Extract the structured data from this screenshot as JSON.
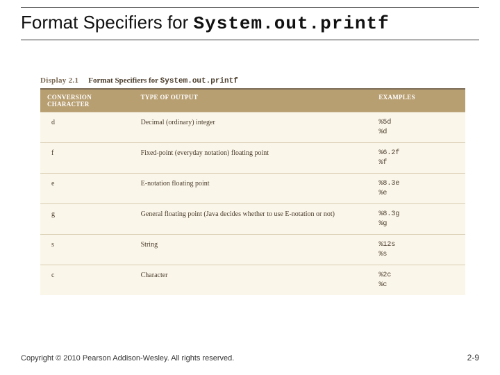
{
  "title": {
    "prefix": "Format Specifiers for ",
    "mono": "System.out.printf"
  },
  "display": {
    "label": "Display 2.1",
    "caption_prefix": "Format Specifiers for ",
    "caption_mono": "System.out.printf"
  },
  "headers": {
    "col1a": "CONVERSION",
    "col1b": "CHARACTER",
    "col2": "TYPE OF OUTPUT",
    "col3": "EXAMPLES"
  },
  "rows": [
    {
      "ch": "d",
      "type": "Decimal (ordinary) integer",
      "ex": "%5d\n%d"
    },
    {
      "ch": "f",
      "type": "Fixed-point (everyday notation) floating point",
      "ex": "%6.2f\n%f"
    },
    {
      "ch": "e",
      "type": "E-notation floating point",
      "ex": "%8.3e\n%e"
    },
    {
      "ch": "g",
      "type": "General floating point (Java decides whether to use E-notation or not)",
      "ex": "%8.3g\n%g"
    },
    {
      "ch": "s",
      "type": "String",
      "ex": "%12s\n%s"
    },
    {
      "ch": "c",
      "type": "Character",
      "ex": "%2c\n%c"
    }
  ],
  "footer": {
    "copyright": "Copyright © 2010 Pearson Addison-Wesley. All rights reserved.",
    "page": "2-9"
  }
}
